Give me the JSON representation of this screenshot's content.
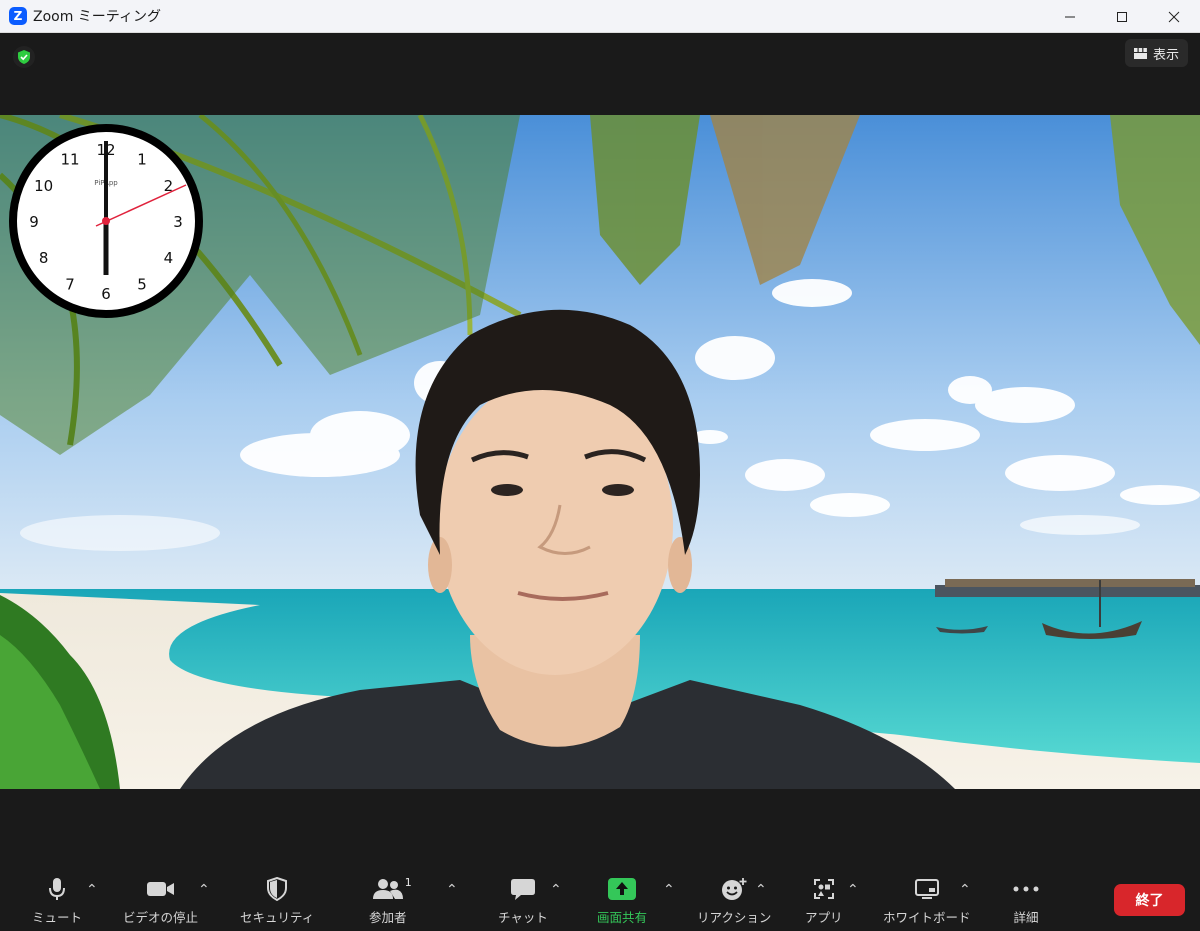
{
  "window": {
    "title": "Zoom ミーティング",
    "app_icon_letter": "Z"
  },
  "topbar": {
    "view_label": "表示"
  },
  "clock": {
    "numbers": [
      "12",
      "1",
      "2",
      "3",
      "4",
      "5",
      "6",
      "7",
      "8",
      "9",
      "10",
      "11"
    ],
    "brand": "PiPApp"
  },
  "toolbar": {
    "mute_label": "ミュート",
    "video_label": "ビデオの停止",
    "security_label": "セキュリティ",
    "participants_label": "参加者",
    "participants_count": "1",
    "chat_label": "チャット",
    "share_label": "画面共有",
    "reaction_label": "リアクション",
    "apps_label": "アプリ",
    "whiteboard_label": "ホワイトボード",
    "more_label": "詳細",
    "end_label": "終了"
  },
  "colors": {
    "share_green": "#34c759",
    "end_red": "#d8262b",
    "zoom_blue": "#0b5cff"
  }
}
